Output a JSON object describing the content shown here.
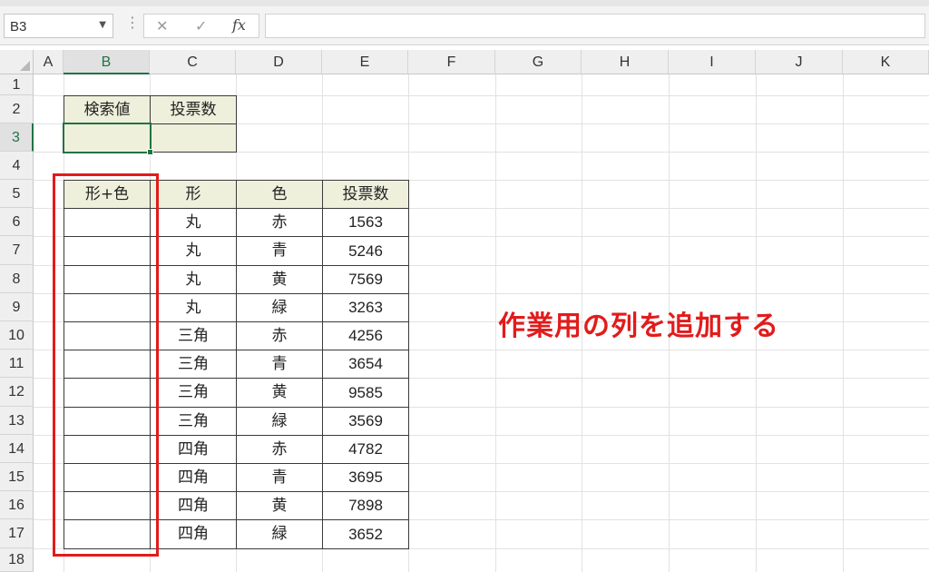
{
  "formula_bar": {
    "name_box_value": "B3",
    "name_box_arrow": "▼",
    "dots": "⋮",
    "cancel_glyph": "✕",
    "enter_glyph": "✓",
    "fx_label": "fx",
    "formula_value": ""
  },
  "columns": [
    "A",
    "B",
    "C",
    "D",
    "E",
    "F",
    "G",
    "H",
    "I",
    "J",
    "K"
  ],
  "rows": [
    "1",
    "2",
    "3",
    "4",
    "5",
    "6",
    "7",
    "8",
    "9",
    "10",
    "11",
    "12",
    "13",
    "14",
    "15",
    "16",
    "17",
    "18"
  ],
  "selected_cell": "B3",
  "search_table": {
    "headers": [
      "検索値",
      "投票数"
    ],
    "values": [
      "",
      ""
    ]
  },
  "data_table": {
    "headers": [
      "形+色",
      "形",
      "色",
      "投票数"
    ],
    "rows": [
      [
        "",
        "丸",
        "赤",
        "1563"
      ],
      [
        "",
        "丸",
        "青",
        "5246"
      ],
      [
        "",
        "丸",
        "黄",
        "7569"
      ],
      [
        "",
        "丸",
        "緑",
        "3263"
      ],
      [
        "",
        "三角",
        "赤",
        "4256"
      ],
      [
        "",
        "三角",
        "青",
        "3654"
      ],
      [
        "",
        "三角",
        "黄",
        "9585"
      ],
      [
        "",
        "三角",
        "緑",
        "3569"
      ],
      [
        "",
        "四角",
        "赤",
        "4782"
      ],
      [
        "",
        "四角",
        "青",
        "3695"
      ],
      [
        "",
        "四角",
        "黄",
        "7898"
      ],
      [
        "",
        "四角",
        "緑",
        "3652"
      ]
    ]
  },
  "annotation": {
    "text": "作業用の列を追加する",
    "color": "#e21b1b"
  },
  "colors": {
    "accent": "#217346",
    "header_fill": "#eef0dc",
    "highlight": "#e21b1b"
  }
}
